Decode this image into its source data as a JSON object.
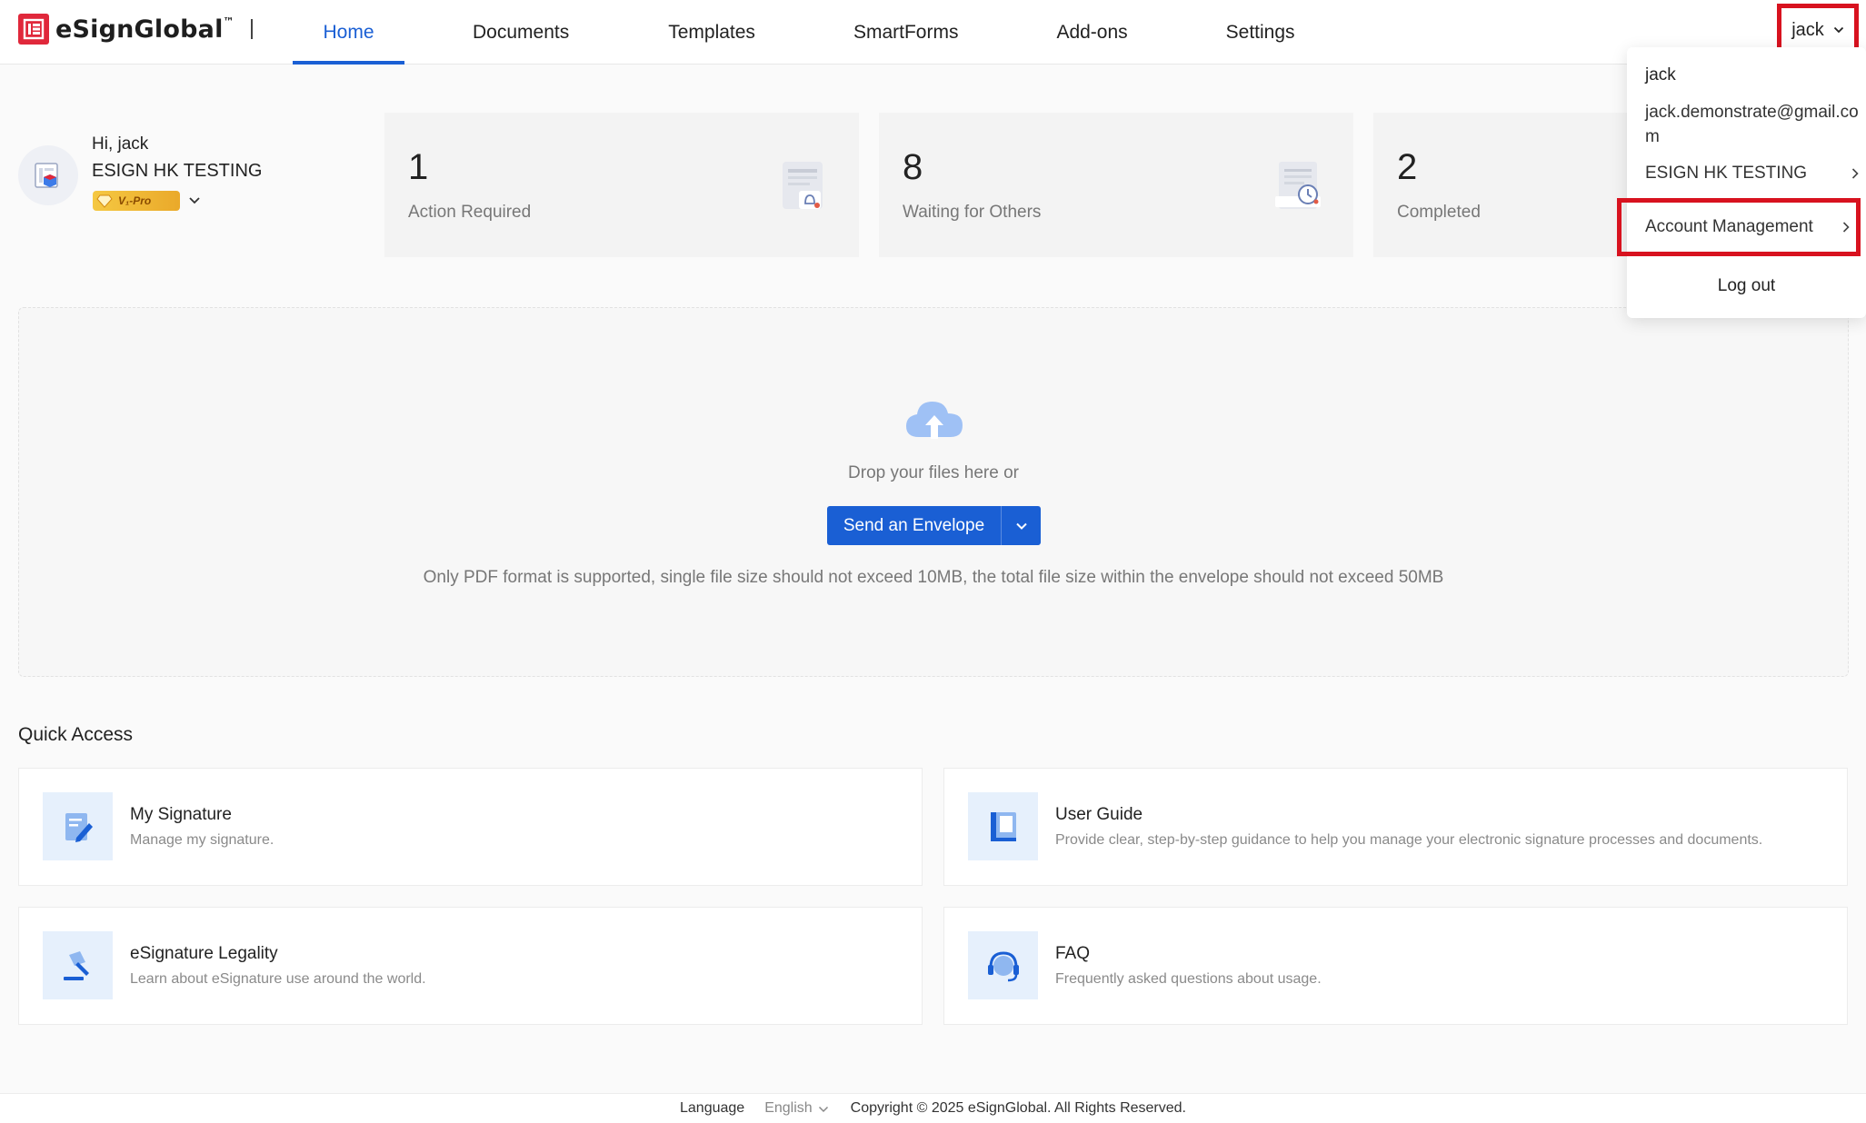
{
  "header": {
    "logo_text": "eSignGlobal",
    "logo_tm": "™",
    "nav": [
      {
        "label": "Home",
        "active": true
      },
      {
        "label": "Documents"
      },
      {
        "label": "Templates"
      },
      {
        "label": "SmartForms"
      },
      {
        "label": "Add-ons"
      },
      {
        "label": "Settings"
      }
    ],
    "user_label": "jack"
  },
  "profile": {
    "greeting": "Hi, jack",
    "company": "ESIGN HK TESTING",
    "badge": "V₁-Pro"
  },
  "stats": [
    {
      "value": "1",
      "label": "Action Required",
      "icon": "document-bell-icon"
    },
    {
      "value": "8",
      "label": "Waiting for Others",
      "icon": "document-clock-icon"
    },
    {
      "value": "2",
      "label": "Completed",
      "icon": "document-check-icon"
    }
  ],
  "user_menu": {
    "name": "jack",
    "email": "jack.demonstrate@gmail.com",
    "organization": "ESIGN HK TESTING",
    "account_management": "Account Management",
    "logout": "Log out"
  },
  "upload": {
    "drop_text": "Drop your files here or",
    "send_button": "Send an Envelope",
    "note": "Only PDF format is supported, single file size should not exceed 10MB, the total file size within the envelope should not exceed 50MB"
  },
  "quick_access": {
    "title": "Quick Access",
    "items": [
      {
        "name": "My Signature",
        "desc": "Manage my signature.",
        "icon": "signature-pen-icon"
      },
      {
        "name": "User Guide",
        "desc": "Provide clear, step-by-step guidance to help you manage your electronic signature processes and documents.",
        "icon": "book-icon"
      },
      {
        "name": "eSignature Legality",
        "desc": "Learn about eSignature use around the world.",
        "icon": "gavel-icon"
      },
      {
        "name": "FAQ",
        "desc": "Frequently asked questions about usage.",
        "icon": "headset-icon"
      }
    ]
  },
  "footer": {
    "language_label": "Language",
    "language_value": "English",
    "copyright": "Copyright © 2025 eSignGlobal. All Rights Reserved."
  },
  "colors": {
    "primary": "#1a5fd4",
    "brand_red": "#e0283b",
    "highlight_red": "#d8121f"
  }
}
